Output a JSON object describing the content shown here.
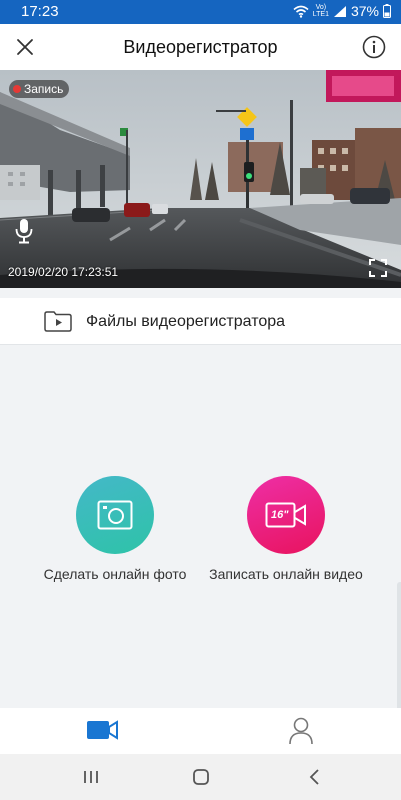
{
  "status_bar": {
    "time": "17:23",
    "network_top": "Vo)",
    "network_bottom": "LTE1",
    "battery": "37%",
    "icons": [
      "wifi-icon",
      "signal-icon",
      "battery-icon"
    ]
  },
  "header": {
    "title": "Видеорегистратор",
    "close_icon": "close-icon",
    "info_icon": "info-icon"
  },
  "video": {
    "rec_badge": "Запись",
    "timestamp": "2019/02/20 17:23:51",
    "mic_icon": "microphone-icon",
    "fullscreen_icon": "fullscreen-icon"
  },
  "files": {
    "label": "Файлы видеорегистратора",
    "icon": "folder-video-icon"
  },
  "actions": {
    "photo_label": "Сделать онлайн фото",
    "video_label": "Записать онлайн видео",
    "video_badge": "16\""
  },
  "tabbar": {
    "tabs": [
      "camera-tab-icon",
      "profile-tab-icon"
    ],
    "active_color": "#1976d2"
  },
  "colors": {
    "status_bar": "#1565c0",
    "photo_button": "#2ec3a8",
    "video_button": "#e8135e"
  }
}
